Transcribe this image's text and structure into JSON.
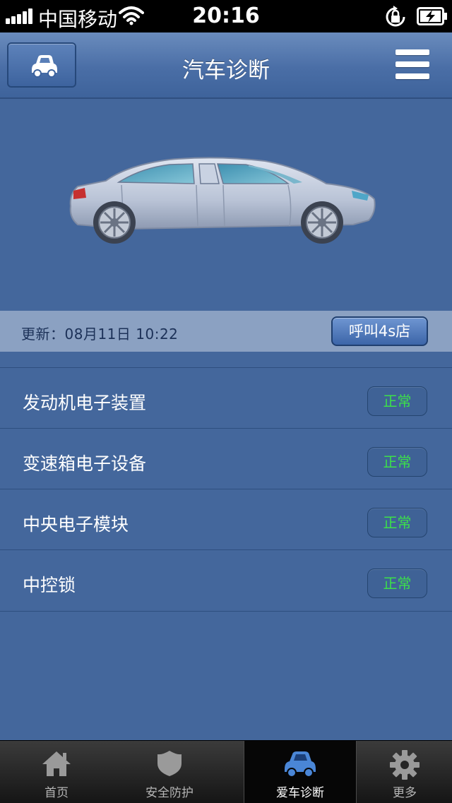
{
  "status_bar": {
    "carrier": "中国移动",
    "time": "20:16"
  },
  "nav": {
    "title": "汽车诊断",
    "left_icon": "car-icon",
    "right_icon": "menu-icon"
  },
  "update": {
    "text": "更新：08月11日 10:22",
    "call_button": "呼叫4s店"
  },
  "diagnostics": [
    {
      "label": "发动机电子装置",
      "status": "正常"
    },
    {
      "label": "变速箱电子设备",
      "status": "正常"
    },
    {
      "label": "中央电子模块",
      "status": "正常"
    },
    {
      "label": "中控锁",
      "status": "正常"
    }
  ],
  "tabs": [
    {
      "label": "首页",
      "icon": "home-icon",
      "active": false
    },
    {
      "label": "安全防护",
      "icon": "shield-icon",
      "active": false
    },
    {
      "label": "爱车诊断",
      "icon": "car-icon",
      "active": true
    },
    {
      "label": "更多",
      "icon": "gear-icon",
      "active": false
    }
  ],
  "colors": {
    "background": "#44679c",
    "status_ok": "#3ce04a",
    "update_bar": "#8ba1c2"
  }
}
